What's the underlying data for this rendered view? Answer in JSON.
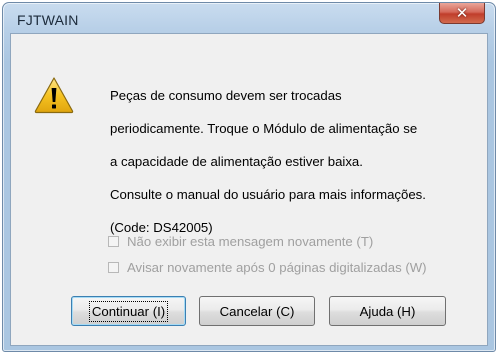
{
  "window": {
    "title": "FJTWAIN",
    "close_glyph": "✕",
    "icon": "warning-icon"
  },
  "message": {
    "lines": [
      "Peças de consumo devem ser trocadas",
      "periodicamente. Troque o Módulo de alimentação se",
      "a capacidade de alimentação estiver baixa.",
      "Consulte o manual do usuário para mais informações.",
      "(Code: DS42005)"
    ]
  },
  "options": {
    "dont_show_again": {
      "label": "Não exibir esta mensagem novamente (T)",
      "checked": false,
      "enabled": false
    },
    "remind_after": {
      "label": "Avisar novamente após 0 páginas digitalizadas (W)",
      "checked": false,
      "enabled": false
    }
  },
  "buttons": {
    "continue": "Continuar (I)",
    "cancel": "Cancelar (C)",
    "help": "Ajuda (H)"
  },
  "colors": {
    "warning_fill": "#f6c322",
    "warning_border": "#8a6a10",
    "disabled_text": "#a0a0a0",
    "close_button": "#c74a3a"
  }
}
